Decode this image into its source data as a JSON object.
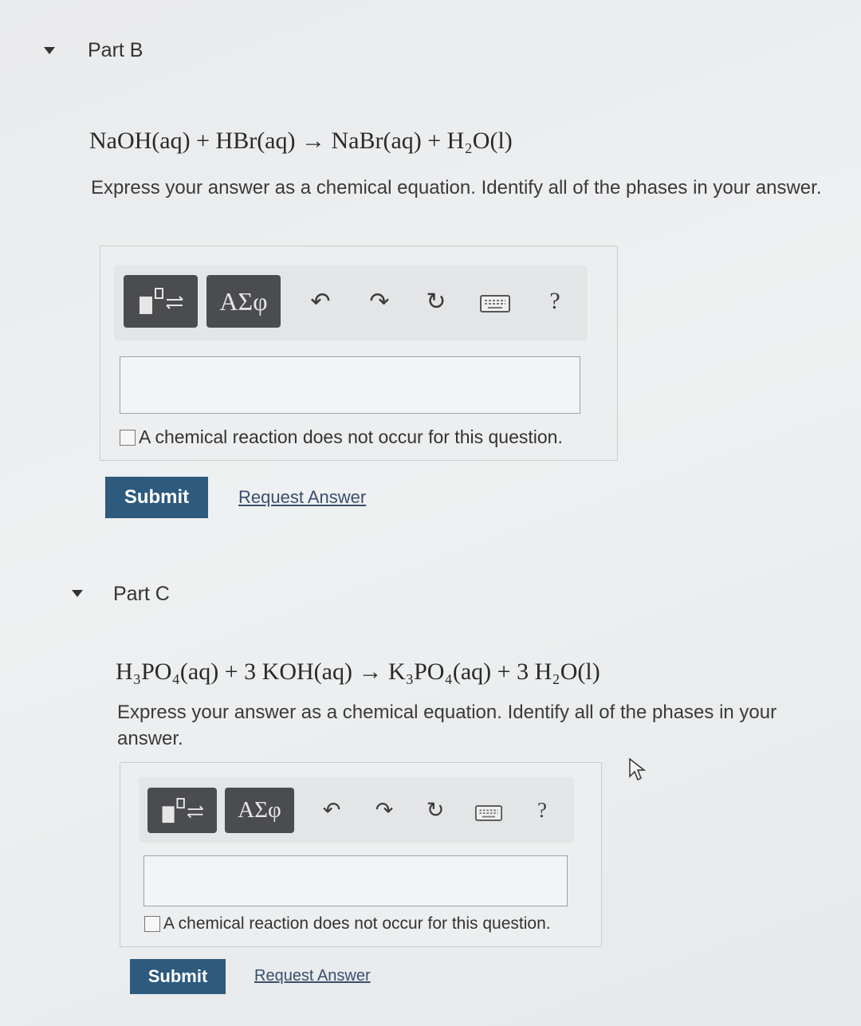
{
  "partB": {
    "title": "Part B",
    "equation": "NaOH(aq) + HBr(aq) → NaBr(aq) + H₂O(l)",
    "prompt": "Express your answer as a chemical equation. Identify all of the phases in your answer.",
    "greek_label": "ΑΣφ",
    "help_label": "?",
    "checkbox_label": "A chemical reaction does not occur for this question.",
    "submit_label": "Submit",
    "request_label": "Request Answer",
    "answer_value": ""
  },
  "partC": {
    "title": "Part C",
    "equation": "H₃PO₄(aq) + 3 KOH(aq) → K₃PO₄(aq) + 3 H₂O(l)",
    "prompt": "Express your answer as a chemical equation. Identify all of the phases in your answer.",
    "greek_label": "ΑΣφ",
    "help_label": "?",
    "checkbox_label": "A chemical reaction does not occur for this question.",
    "submit_label": "Submit",
    "request_label": "Request Answer",
    "answer_value": ""
  },
  "icons": {
    "collapse": "caret-down-icon",
    "templates": "templates-icon",
    "undo": "undo-icon",
    "redo": "redo-icon",
    "reset": "reset-icon",
    "keyboard": "keyboard-icon",
    "help": "help-icon",
    "cursor": "mouse-cursor-icon"
  },
  "colors": {
    "submit_bg": "#2d5a7d",
    "toolbar_button_bg": "#4a4c4f",
    "link": "#3a4f6e"
  }
}
